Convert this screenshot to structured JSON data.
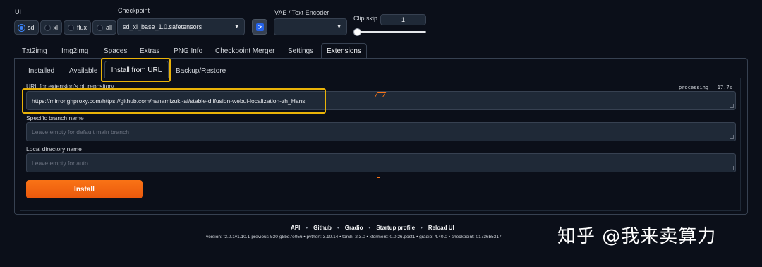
{
  "top": {
    "ui_label": "UI",
    "ui_options": [
      {
        "label": "sd",
        "selected": true
      },
      {
        "label": "xl",
        "selected": false
      },
      {
        "label": "flux",
        "selected": false
      },
      {
        "label": "all",
        "selected": false
      }
    ],
    "checkpoint_label": "Checkpoint",
    "checkpoint_value": "sd_xl_base_1.0.safetensors",
    "vae_label": "VAE / Text Encoder",
    "vae_value": "",
    "clip_skip_label": "Clip skip",
    "clip_skip_value": "1",
    "clip_skip_fraction": 0.0
  },
  "main_tabs": [
    "Txt2img",
    "Img2img",
    "Spaces",
    "Extras",
    "PNG Info",
    "Checkpoint Merger",
    "Settings",
    "Extensions"
  ],
  "active_main_tab": "Extensions",
  "sub_tabs": [
    "Installed",
    "Available",
    "Install from URL",
    "Backup/Restore"
  ],
  "active_sub_tab": "Install from URL",
  "form": {
    "url_label": "URL for extension's git repository",
    "url_value": "https://mirror.ghproxy.com/https://github.com/hanamizuki-ai/stable-diffusion-webui-localization-zh_Hans",
    "status_text": "processing | 17.7s",
    "branch_label": "Specific branch name",
    "branch_placeholder": "Leave empty for default main branch",
    "dir_label": "Local directory name",
    "dir_placeholder": "Leave empty for auto",
    "install_label": "Install"
  },
  "footer": {
    "links": [
      "API",
      "Github",
      "Gradio",
      "Startup profile",
      "Reload UI"
    ],
    "version": "version: f2.0.1v1.10.1-previous-530-g8bd7e056  •  python: 3.10.14  •  torch: 2.3.0  •  xformers: 0.0.26.post1  •  gradio: 4.40.0  •  checkpoint: 01736b5317"
  },
  "watermark": "知乎 @我来卖算力",
  "colors": {
    "background": "#0b0f19",
    "accent_orange": "#f97316",
    "highlight_yellow": "#eab308",
    "radio_blue": "#3b82f6"
  },
  "icons": {
    "refresh": "refresh-icon",
    "dropdown": "chevron-down-icon"
  }
}
